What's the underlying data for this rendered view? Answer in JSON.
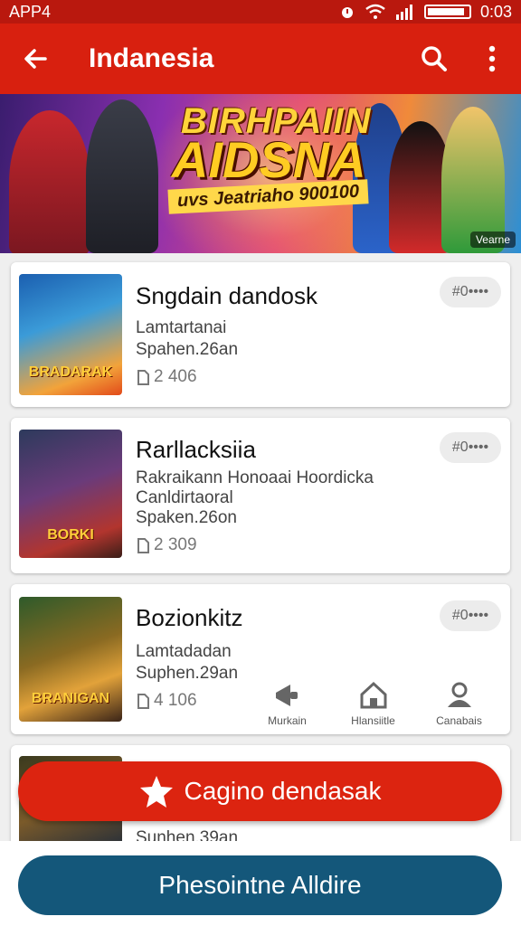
{
  "status_bar": {
    "app_label": "APP4",
    "time": "0:03"
  },
  "app_bar": {
    "title": "Indanesia"
  },
  "banner": {
    "headline_1": "BIRHPAIIN",
    "headline_2": "AIDSNA",
    "subline": "uvs Jeatriaho 900100",
    "corner_tag": "Vearne"
  },
  "cards": [
    {
      "title": "Sngdain dandosk",
      "thumb_label": "BRADARAK",
      "lines": [
        "Lamtartanai",
        "Spahen.26an"
      ],
      "meta": "2 406",
      "pill": "#0••••"
    },
    {
      "title": "Rarllacksiia",
      "thumb_label": "BORKI",
      "lines": [
        "Rakraikann Honoaai Hoordicka",
        "Canldirtaoral",
        "Spaken.26on"
      ],
      "meta": "2 309",
      "pill": "#0••••"
    },
    {
      "title": "Bozionkitz",
      "thumb_label": "BRANIGAN",
      "lines": [
        "Lamtadadan",
        "Suphen.29an"
      ],
      "meta": "4 106",
      "pill": "#0••••"
    },
    {
      "title": "",
      "thumb_label": "",
      "lines": [
        "Sunhen.39an"
      ],
      "meta": "",
      "pill": ""
    }
  ],
  "mini_nav": [
    {
      "label": "Murkain",
      "icon": "megaphone-icon"
    },
    {
      "label": "Hlansiitle",
      "icon": "home-icon"
    },
    {
      "label": "Canabais",
      "icon": "person-icon"
    }
  ],
  "fab": {
    "label": "Cagino dendasak",
    "icon": "star-icon"
  },
  "primary_button": {
    "label": "Phesointne Alldire"
  },
  "colors": {
    "primary_red": "#d8200f",
    "dark_red": "#b9180e",
    "navy": "#14577a"
  }
}
